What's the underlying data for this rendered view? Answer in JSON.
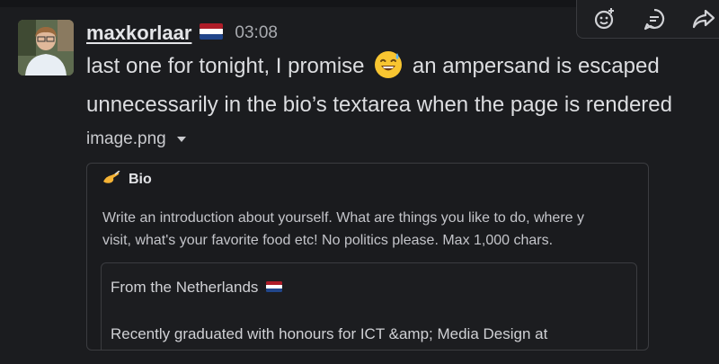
{
  "actions": {
    "icons": [
      "add-reaction-icon",
      "reply-in-thread-icon",
      "share-icon"
    ]
  },
  "message": {
    "username": "maxkorlaar",
    "flag": "🇳🇱",
    "timestamp": "03:08",
    "text_before_emoji": "last one for tonight, I promise",
    "emoji": "😅",
    "text_after_emoji": "an ampersand is escaped",
    "text_line2": "unnecessarily in the bio’s textarea when the page is rendered"
  },
  "attachment": {
    "filename": "image.png"
  },
  "preview": {
    "title_emoji": "✍",
    "title": "Bio",
    "description_line1": "Write an introduction about yourself. What are things you like to do, where y",
    "description_line2": "visit, what's your favorite food etc! No politics please. Max 1,000 chars.",
    "textarea_line1": "From the Netherlands",
    "textarea_flag": "🇳🇱",
    "textarea_line2": "Recently graduated with honours for ICT &amp; Media Design at"
  },
  "colors": {
    "background": "#1b1c1f",
    "text": "#dcdde0",
    "muted": "#a9abb0",
    "border": "#3b3c40"
  }
}
